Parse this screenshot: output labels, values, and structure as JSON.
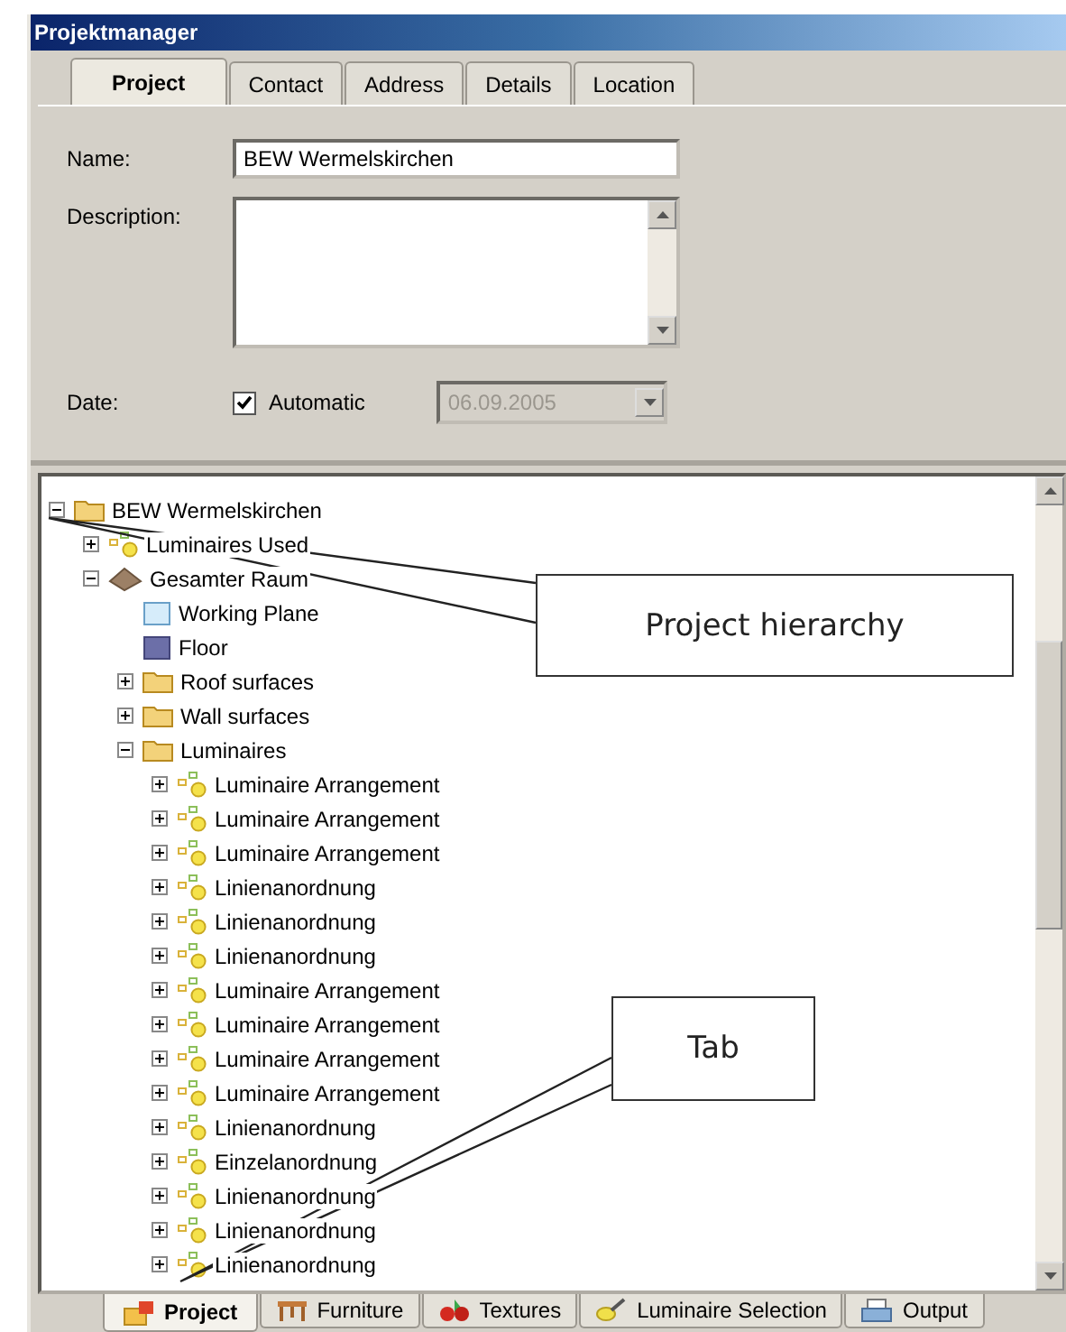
{
  "window": {
    "title": "Projektmanager"
  },
  "tabs": [
    {
      "label": "Project",
      "selected": true
    },
    {
      "label": "Contact",
      "selected": false
    },
    {
      "label": "Address",
      "selected": false
    },
    {
      "label": "Details",
      "selected": false
    },
    {
      "label": "Location",
      "selected": false
    }
  ],
  "form": {
    "name": {
      "label": "Name:",
      "value": "BEW Wermelskirchen"
    },
    "description": {
      "label": "Description:"
    },
    "date": {
      "label": "Date:",
      "automatic": {
        "label": "Automatic",
        "checked": true
      },
      "value": "06.09.2005",
      "disabled": true
    }
  },
  "tree": [
    {
      "label": "BEW Wermelskirchen",
      "kind": "folder",
      "expanded": true,
      "children": [
        {
          "label": "Luminaires Used",
          "kind": "arrangement",
          "expanded": false
        },
        {
          "label": "Gesamter Raum",
          "kind": "room",
          "expanded": true,
          "children": [
            {
              "label": "Working Plane",
              "kind": "plane"
            },
            {
              "label": "Floor",
              "kind": "floor"
            },
            {
              "label": "Roof surfaces",
              "kind": "folder",
              "expanded": false
            },
            {
              "label": "Wall surfaces",
              "kind": "folder",
              "expanded": false
            },
            {
              "label": "Luminaires",
              "kind": "folder",
              "expanded": true,
              "children": [
                {
                  "label": "Luminaire Arrangement",
                  "kind": "arrangement",
                  "expanded": false
                },
                {
                  "label": "Luminaire Arrangement",
                  "kind": "arrangement",
                  "expanded": false
                },
                {
                  "label": "Luminaire Arrangement",
                  "kind": "arrangement",
                  "expanded": false
                },
                {
                  "label": "Linienanordnung",
                  "kind": "arrangement",
                  "expanded": false
                },
                {
                  "label": "Linienanordnung",
                  "kind": "arrangement",
                  "expanded": false
                },
                {
                  "label": "Linienanordnung",
                  "kind": "arrangement",
                  "expanded": false
                },
                {
                  "label": "Luminaire Arrangement",
                  "kind": "arrangement",
                  "expanded": false
                },
                {
                  "label": "Luminaire Arrangement",
                  "kind": "arrangement",
                  "expanded": false
                },
                {
                  "label": "Luminaire Arrangement",
                  "kind": "arrangement",
                  "expanded": false
                },
                {
                  "label": "Luminaire Arrangement",
                  "kind": "arrangement",
                  "expanded": false
                },
                {
                  "label": "Linienanordnung",
                  "kind": "arrangement",
                  "expanded": false
                },
                {
                  "label": "Einzelanordnung",
                  "kind": "arrangement",
                  "expanded": false
                },
                {
                  "label": "Linienanordnung",
                  "kind": "arrangement",
                  "expanded": false
                },
                {
                  "label": "Linienanordnung",
                  "kind": "arrangement",
                  "expanded": false
                },
                {
                  "label": "Linienanordnung",
                  "kind": "arrangement",
                  "expanded": false
                }
              ]
            }
          ]
        }
      ]
    }
  ],
  "bottom_tabs": [
    {
      "label": "Project",
      "kind": "project",
      "selected": true
    },
    {
      "label": "Furniture",
      "kind": "furniture",
      "selected": false
    },
    {
      "label": "Textures",
      "kind": "textures",
      "selected": false
    },
    {
      "label": "Luminaire Selection",
      "kind": "luminaire",
      "selected": false
    },
    {
      "label": "Output",
      "kind": "output",
      "selected": false
    }
  ],
  "callouts": [
    {
      "text": "Project hierarchy"
    },
    {
      "text": "Tab"
    }
  ]
}
